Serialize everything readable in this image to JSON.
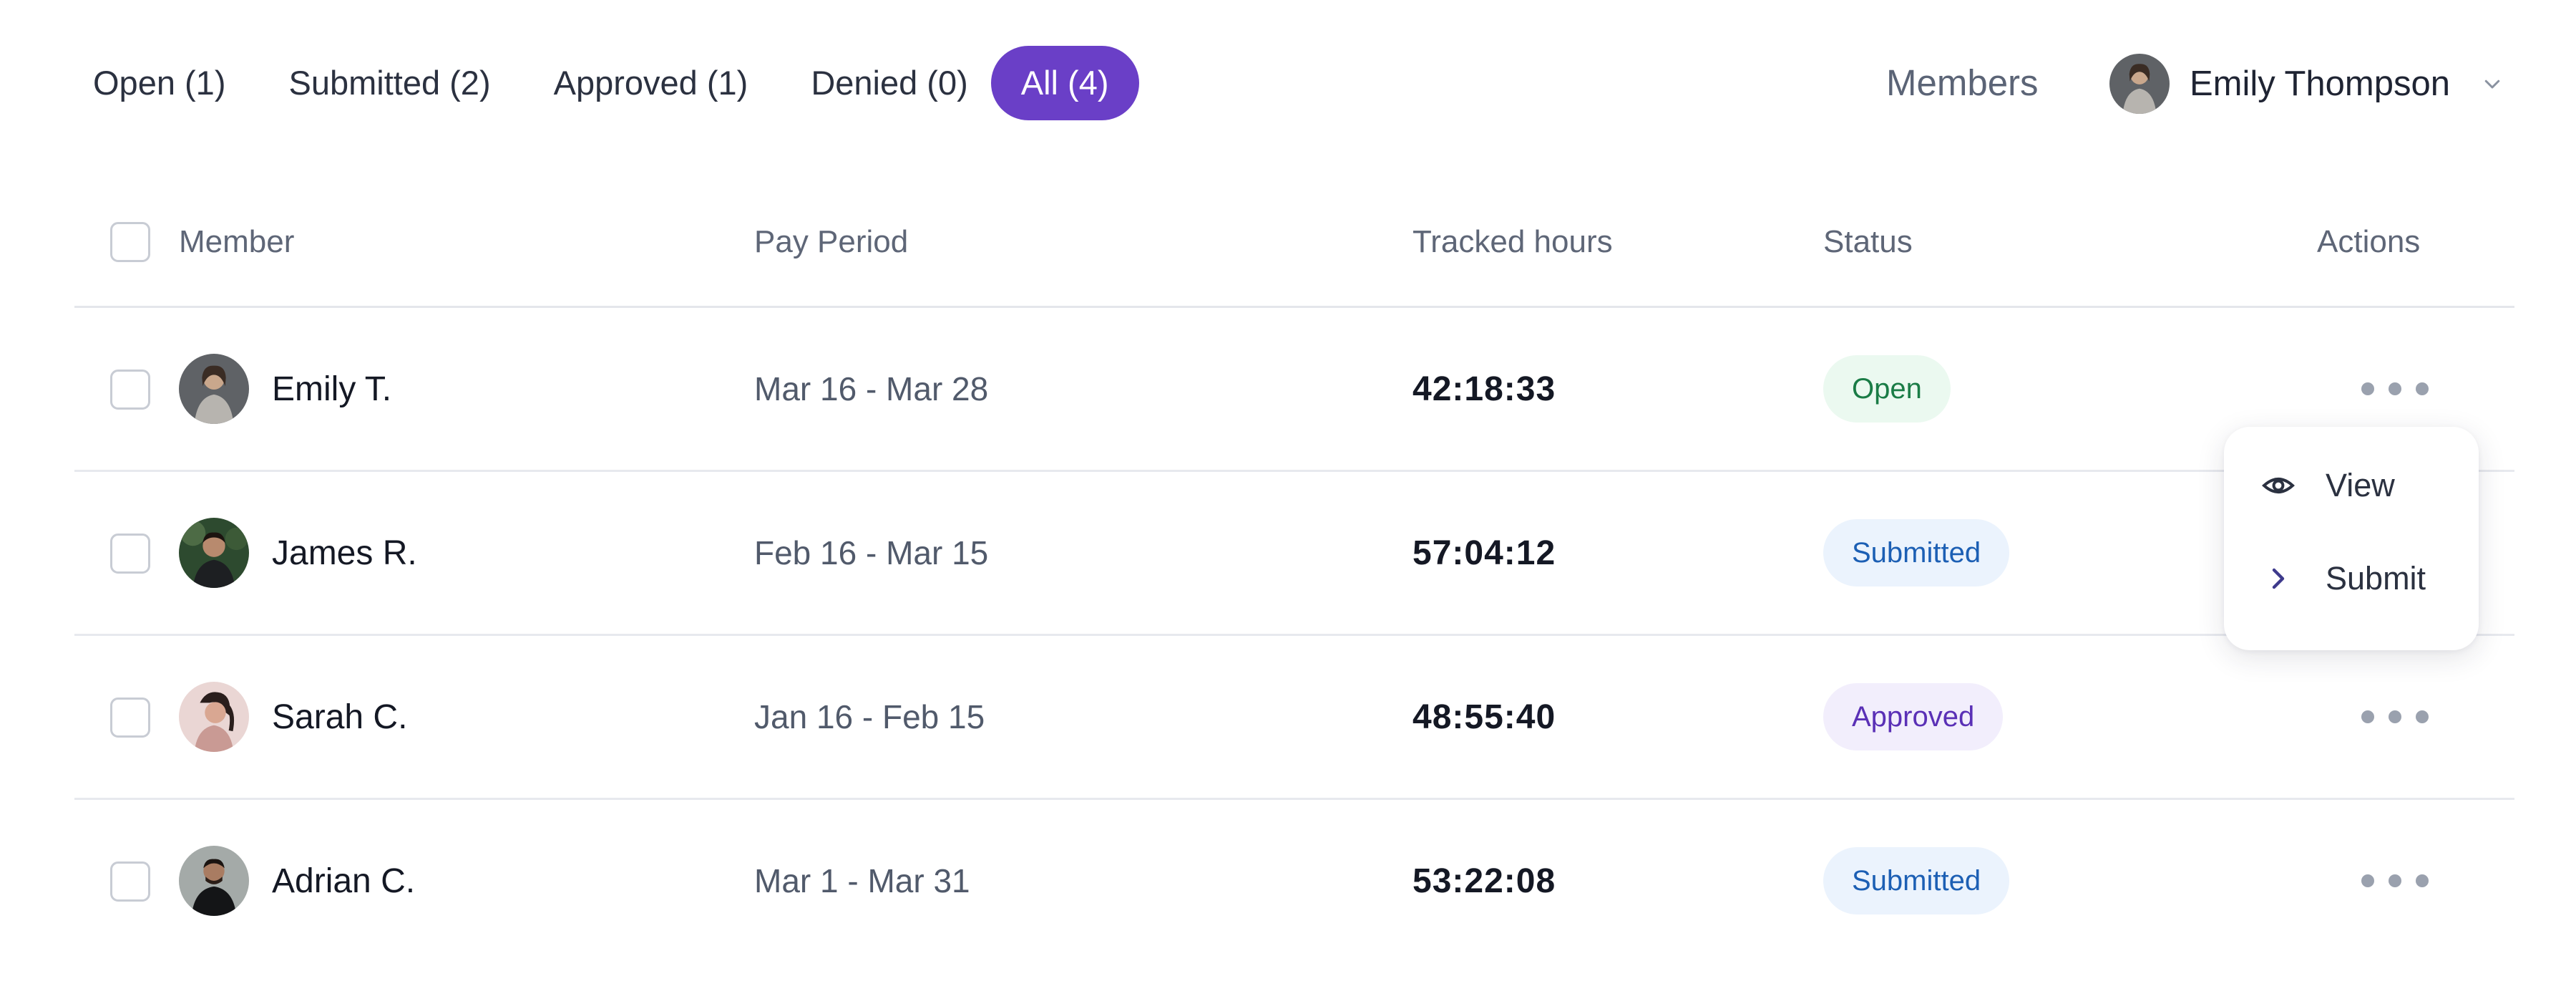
{
  "tabs": [
    {
      "label": "Open (1)"
    },
    {
      "label": "Submitted (2)"
    },
    {
      "label": "Approved (1)"
    },
    {
      "label": "Denied (0)"
    },
    {
      "label": "All (4)",
      "active": true
    }
  ],
  "header": {
    "members_link": "Members",
    "user_name": "Emily Thompson",
    "user_avatar_icon": "avatar-photo",
    "dropdown_icon": "chevron-down-icon"
  },
  "table": {
    "columns": {
      "member": "Member",
      "pay_period": "Pay Period",
      "tracked_hours": "Tracked hours",
      "status": "Status",
      "actions": "Actions"
    },
    "rows": [
      {
        "member": "Emily T.",
        "pay_period": "Mar 16 - Mar 28",
        "tracked_hours": "42:18:33",
        "status": "Open"
      },
      {
        "member": "James R.",
        "pay_period": "Feb 16 - Mar 15",
        "tracked_hours": "57:04:12",
        "status": "Submitted"
      },
      {
        "member": "Sarah C.",
        "pay_period": "Jan 16 - Feb 15",
        "tracked_hours": "48:55:40",
        "status": "Approved"
      },
      {
        "member": "Adrian C.",
        "pay_period": "Mar 1 - Mar 31",
        "tracked_hours": "53:22:08",
        "status": "Submitted"
      }
    ]
  },
  "actions_menu": {
    "items": [
      {
        "label": "View",
        "icon": "eye-icon"
      },
      {
        "label": "Submit",
        "icon": "chevron-right-icon"
      }
    ]
  },
  "colors": {
    "accent": "#6a3fc7",
    "status_open": "#1a7c46",
    "status_submitted": "#1c5fb4",
    "status_approved": "#5a30b6"
  }
}
